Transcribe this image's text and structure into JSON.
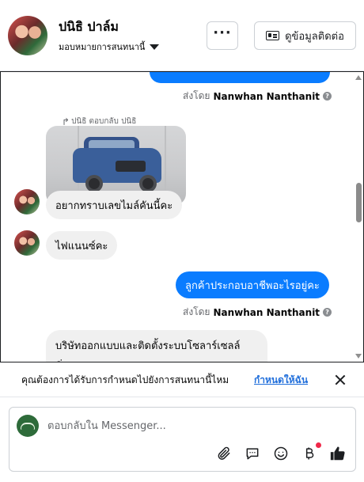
{
  "header": {
    "contact_name": "ปนิธิ ปาล์ม",
    "assign_label": "มอบหมายการสนทนานี้",
    "more_label": "···",
    "contact_info_label": "ดูข้อมูลติดต่อ"
  },
  "conversation": {
    "top_sent_by_prefix": "ส่งโดย",
    "top_sent_by_name": "Nanwhan Nanthanit",
    "reply_header": "ปนิธิ ตอบกลับ ปนิธิ",
    "msg_mileage": "อยากทราบเลขไมล์คันนี้คะ",
    "msg_finance": "ไฟแนนซ์คะ",
    "msg_occupation": "ลูกค้าประกอบอาชีพอะไรอยู่คะ",
    "mid_sent_by_prefix": "ส่งโดย",
    "mid_sent_by_name": "Nanwhan Nanthanit",
    "msg_company": "บริษัทออกแบบและติดตั้งระบบโซลาร์เซลล์",
    "msg_company_end": "ค่ะ"
  },
  "notice": {
    "text": "คุณต้องการได้รับการกำหนดไปยังการสนทนานี้ไหม",
    "link": "กำหนดให้ฉัน"
  },
  "composer": {
    "placeholder": "ตอบกลับใน Messenger..."
  },
  "icons": [
    "paperclip-icon",
    "saved-reply-icon",
    "emoji-icon",
    "baht-icon",
    "thumbs-up-icon",
    "close-icon",
    "contact-card-icon"
  ],
  "colors": {
    "accent": "#0a7cff",
    "link": "#216fdb",
    "notification": "#f02849"
  }
}
